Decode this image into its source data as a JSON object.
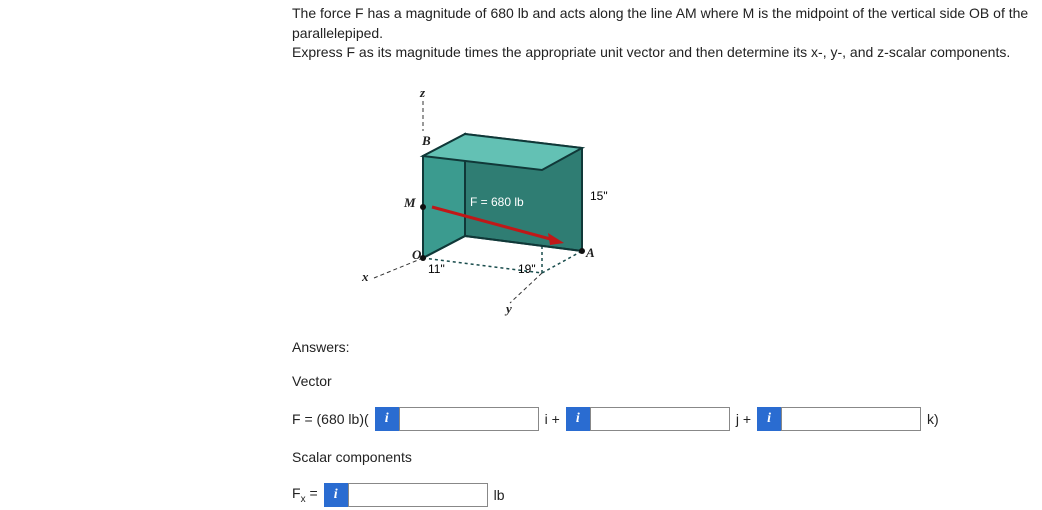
{
  "problem": {
    "line1": "The force F has a magnitude of 680 lb and acts along the line AM where M is the midpoint of the vertical side OB of the parallelepiped.",
    "line2": "Express F as its magnitude times the appropriate unit vector and then determine its x-, y-, and z-scalar components."
  },
  "figure": {
    "axes": {
      "z": "z",
      "x": "x",
      "y": "y"
    },
    "points": {
      "B": "B",
      "M": "M",
      "O": "O",
      "A": "A"
    },
    "force_label": "F = 680 lb",
    "dims": {
      "height": "15\"",
      "depth": "11\"",
      "width": "19\""
    }
  },
  "answers": {
    "heading": "Answers:",
    "vector_heading": "Vector",
    "vector_prefix": "F = (680 lb)(",
    "i_plus": "i +",
    "j_plus": "j +",
    "k_close": "k)",
    "scalar_heading": "Scalar components",
    "fx_label_pre": "F",
    "fx_label_sub": "x",
    "fx_label_post": " =",
    "fx_unit": "lb",
    "info_glyph": "i"
  }
}
